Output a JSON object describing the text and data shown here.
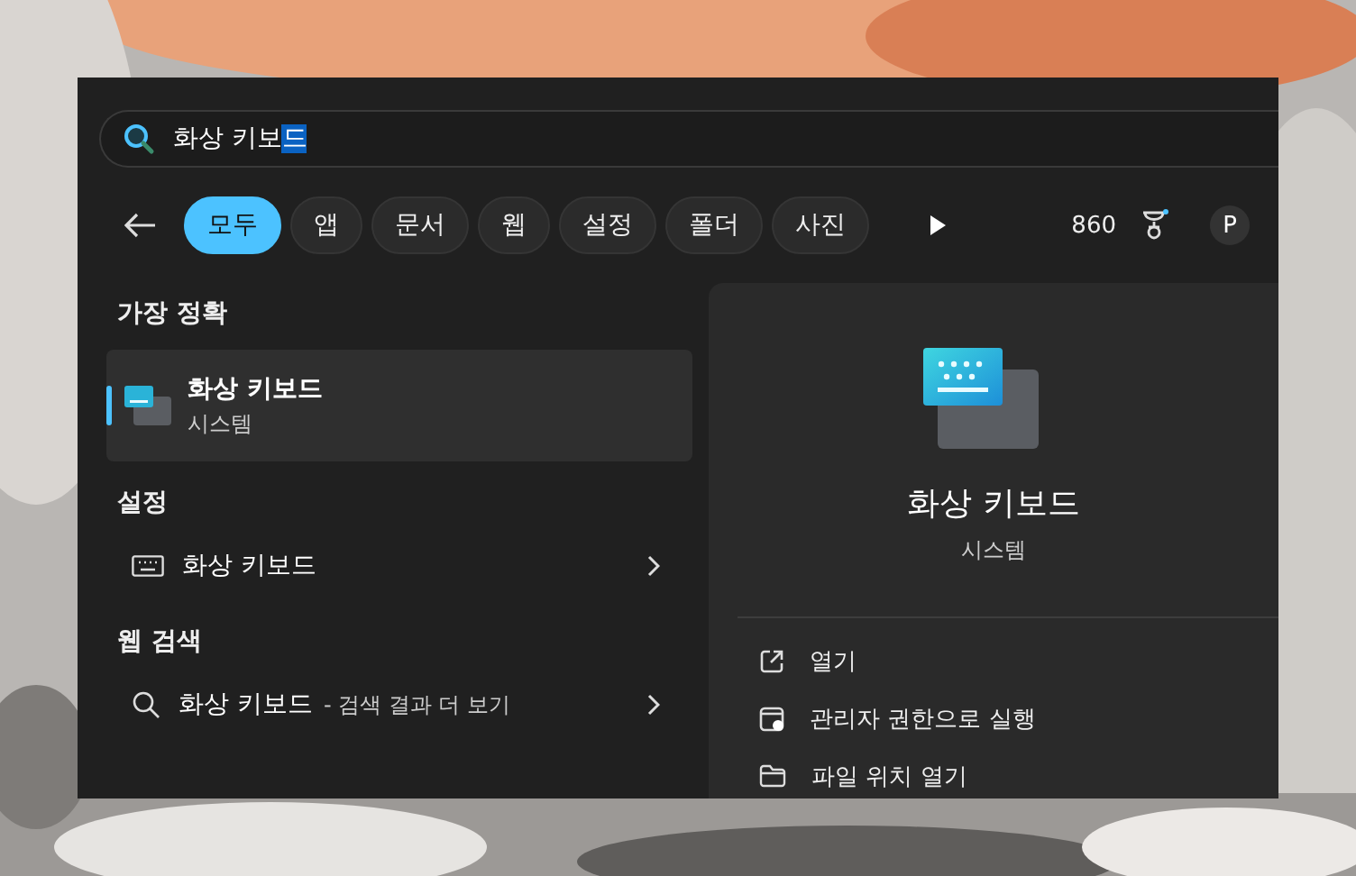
{
  "search": {
    "text": "화상 키보",
    "selection": "드"
  },
  "filters": [
    {
      "label": "모두",
      "selected": true
    },
    {
      "label": "앱",
      "selected": false
    },
    {
      "label": "문서",
      "selected": false
    },
    {
      "label": "웹",
      "selected": false
    },
    {
      "label": "설정",
      "selected": false
    },
    {
      "label": "폴더",
      "selected": false
    },
    {
      "label": "사진",
      "selected": false
    }
  ],
  "points": "860",
  "avatar": "P",
  "sections": [
    {
      "title": "가장 정확",
      "items": [
        {
          "kind": "best",
          "title": "화상 키보드",
          "subtitle": "시스템",
          "selected": true
        }
      ]
    },
    {
      "title": "설정",
      "items": [
        {
          "kind": "setting",
          "title": "화상 키보드",
          "selected": false
        }
      ]
    },
    {
      "title": "웹 검색",
      "items": [
        {
          "kind": "web",
          "title": "화상 키보드",
          "suffix": "- 검색 결과 더 보기",
          "selected": false
        }
      ]
    }
  ],
  "detail": {
    "title": "화상 키보드",
    "subtitle": "시스템",
    "actions": [
      {
        "kind": "open",
        "label": "열기"
      },
      {
        "kind": "admin",
        "label": "관리자 권한으로 실행"
      },
      {
        "kind": "folder",
        "label": "파일 위치 열기"
      }
    ]
  }
}
